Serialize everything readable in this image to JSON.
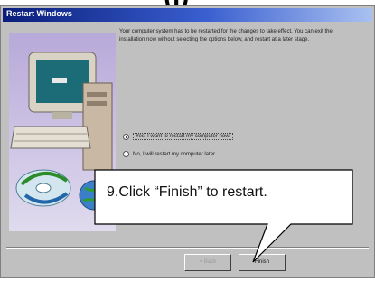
{
  "heading_fragment": "(j)",
  "dialog": {
    "title": "Restart Windows",
    "intro": "Your computer system has to be restarted for the changes to take effect. You can exit the installation now without selecting the options below, and restart at a later stage.",
    "options": [
      {
        "label": "Yes, I want to restart my computer now.",
        "selected": true
      },
      {
        "label": "No, I will restart my computer later.",
        "selected": false
      }
    ],
    "buttons": {
      "back": "< Back",
      "finish": "Finish"
    }
  },
  "callout": {
    "text": "9.Click “Finish” to restart."
  },
  "colors": {
    "titlebar_start": "#0a1d7a",
    "titlebar_end": "#a9c1f0",
    "dialog_bg": "#c0c0c0"
  }
}
